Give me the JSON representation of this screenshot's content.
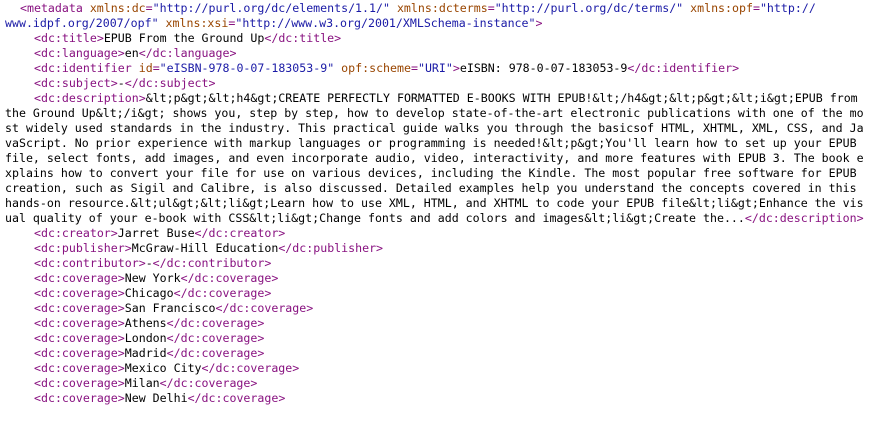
{
  "colors": {
    "tag": "#881280",
    "attr_name": "#994500",
    "attr_value": "#1a1aa6",
    "text": "#000000",
    "background": "#ffffff"
  },
  "metadata_open": {
    "tag_start": "<metadata",
    "attrs": [
      {
        "name": "xmlns:dc",
        "value": "\"http://purl.org/dc/elements/1.1/\""
      },
      {
        "name": "xmlns:dcterms",
        "value": "\"http://purl.org/dc/terms/\""
      },
      {
        "name": "xmlns:opf",
        "value": "\"http://www.idpf.org/2007/opf\""
      },
      {
        "name": "xmlns:xsi",
        "value": "\"http://www.w3.org/2001/XMLSchema-instance\""
      }
    ],
    "tag_end": ">"
  },
  "title": {
    "open": "<dc:title>",
    "text": "EPUB From the Ground Up",
    "close": "</dc:title>"
  },
  "language": {
    "open": "<dc:language>",
    "text": "en",
    "close": "</dc:language>"
  },
  "identifier": {
    "open_start": "<dc:identifier",
    "attr1_name": "id",
    "attr1_value": "\"eISBN-978-0-07-183053-9\"",
    "attr2_name": "opf:scheme",
    "attr2_value": "\"URI\"",
    "open_end": ">",
    "text": "eISBN: 978-0-07-183053-9",
    "close": "</dc:identifier>"
  },
  "subject": {
    "open": "<dc:subject>",
    "text": "-",
    "close": "</dc:subject>"
  },
  "description": {
    "open": "<dc:description>",
    "text": "&lt;p&gt;&lt;h4&gt;CREATE PERFECTLY FORMATTED E-BOOKS WITH EPUB!&lt;/h4&gt;&lt;p&gt;&lt;i&gt;EPUB from the Ground Up&lt;/i&gt; shows you, step by step, how to develop state-of-the-art electronic publications with one of the most widely used standards in the industry. This practical guide walks you through the basicsof HTML, XHTML, XML, CSS, and JavaScript. No prior experience with markup languages or programming is needed!&lt;p&gt;You'll learn how to set up your EPUB file, select fonts, add images, and even incorporate audio, video, interactivity, and more features with EPUB 3. The book explains how to convert your file for use on various devices, including the Kindle. The most popular free software for EPUB creation, such as Sigil and Calibre, is also discussed. Detailed examples help you understand the concepts covered in this hands-on resource.&lt;ul&gt;&lt;li&gt;Learn how to use XML, HTML, and XHTML to code your EPUB file&lt;li&gt;Enhance the visual quality of your e-book with CSS&lt;li&gt;Change fonts and add colors and images&lt;li&gt;Create the...",
    "close": "</dc:description>"
  },
  "creator": {
    "open": "<dc:creator>",
    "text": "Jarret Buse",
    "close": "</dc:creator>"
  },
  "publisher": {
    "open": "<dc:publisher>",
    "text": "McGraw-Hill Education",
    "close": "</dc:publisher>"
  },
  "contributor": {
    "open": "<dc:contributor>",
    "text": "-",
    "close": "</dc:contributor>"
  },
  "coverage_open": "<dc:coverage>",
  "coverage_close": "</dc:coverage>",
  "coverages": [
    "New York",
    "Chicago",
    "San Francisco",
    "Athens",
    "London",
    "Madrid",
    "Mexico City",
    "Milan",
    "New Delhi"
  ]
}
